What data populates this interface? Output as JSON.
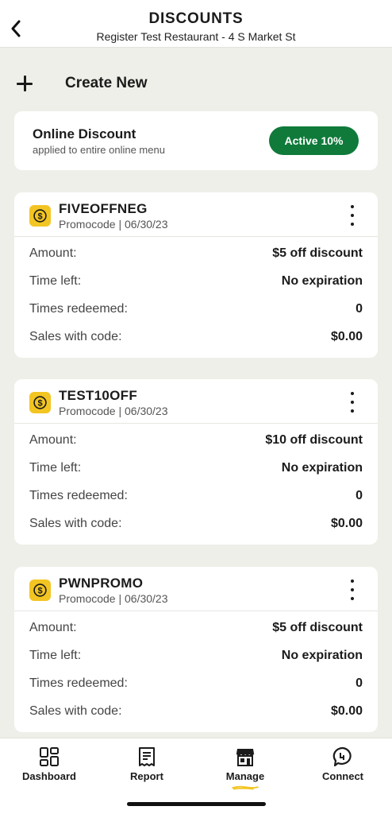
{
  "header": {
    "title": "DISCOUNTS",
    "subtitle": "Register Test Restaurant - 4 S Market St"
  },
  "create": {
    "label": "Create New"
  },
  "online_discount": {
    "title": "Online Discount",
    "subtitle": "applied to entire online menu",
    "status": "Active 10%"
  },
  "labels": {
    "amount": "Amount:",
    "time_left": "Time left:",
    "times_redeemed": "Times redeemed:",
    "sales": "Sales with code:"
  },
  "promos": [
    {
      "code": "FIVEOFFNEG",
      "meta": "Promocode | 06/30/23",
      "amount": "$5 off discount",
      "time_left": "No expiration",
      "times_redeemed": "0",
      "sales": "$0.00"
    },
    {
      "code": "TEST10OFF",
      "meta": "Promocode | 06/30/23",
      "amount": "$10 off discount",
      "time_left": "No expiration",
      "times_redeemed": "0",
      "sales": "$0.00"
    },
    {
      "code": "PWNPROMO",
      "meta": "Promocode | 06/30/23",
      "amount": "$5 off discount",
      "time_left": "No expiration",
      "times_redeemed": "0",
      "sales": "$0.00"
    }
  ],
  "nav": {
    "items": [
      {
        "label": "Dashboard",
        "icon": "dashboard-icon"
      },
      {
        "label": "Report",
        "icon": "receipt-icon"
      },
      {
        "label": "Manage",
        "icon": "storefront-icon"
      },
      {
        "label": "Connect",
        "icon": "chat-icon"
      }
    ],
    "active": "Manage"
  },
  "colors": {
    "background": "#efefe9",
    "active_green": "#0f7a3a",
    "coin_yellow": "#f3c522",
    "underline_yellow": "#f3c522"
  }
}
